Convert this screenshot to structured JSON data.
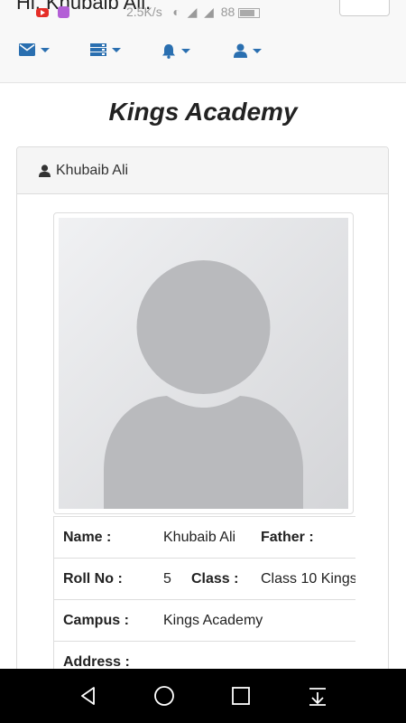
{
  "status_bar": {
    "greeting": "Hi, Khubaib Ali.",
    "network_speed": "2.5K/s",
    "battery": "88"
  },
  "nav": {
    "items": [
      {
        "name": "envelope-icon"
      },
      {
        "name": "server-icon"
      },
      {
        "name": "bell-icon"
      },
      {
        "name": "user-icon"
      }
    ]
  },
  "page": {
    "title": "Kings Academy"
  },
  "profile": {
    "heading": "Khubaib Ali",
    "fields": {
      "name_label": "Name :",
      "name_value": "Khubaib Ali",
      "father_label": "Father :",
      "roll_label": "Roll No :",
      "roll_value": "5",
      "class_label": "Class :",
      "class_value": "Class 10 Kings",
      "campus_label": "Campus :",
      "campus_value": "Kings Academy",
      "address_label": "Address :"
    }
  },
  "colors": {
    "nav_icon": "#2a6fb0",
    "panel_heading_bg": "#f5f5f5"
  }
}
